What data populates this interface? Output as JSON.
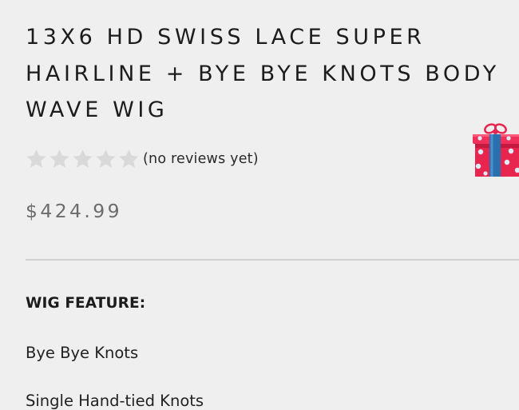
{
  "product": {
    "title": "13X6 HD SWISS LACE SUPER\nHAIRLINE + BYE BYE KNOTS BODY\nWAVE WIG",
    "rating": 0,
    "rating_max": 5,
    "review_text": "(no reviews yet)",
    "price": "$424.99"
  },
  "features": {
    "heading": "WIG FEATURE:",
    "items": [
      "Bye Bye Knots",
      "Single Hand-tied Knots"
    ]
  },
  "icons": {
    "star": "star-icon",
    "gift": "gift-box-icon"
  },
  "colors": {
    "star_empty": "#d9d9d9",
    "price": "#6c6c6c",
    "gift_box": "#e8254f",
    "gift_ribbon": "#2a6fae"
  }
}
